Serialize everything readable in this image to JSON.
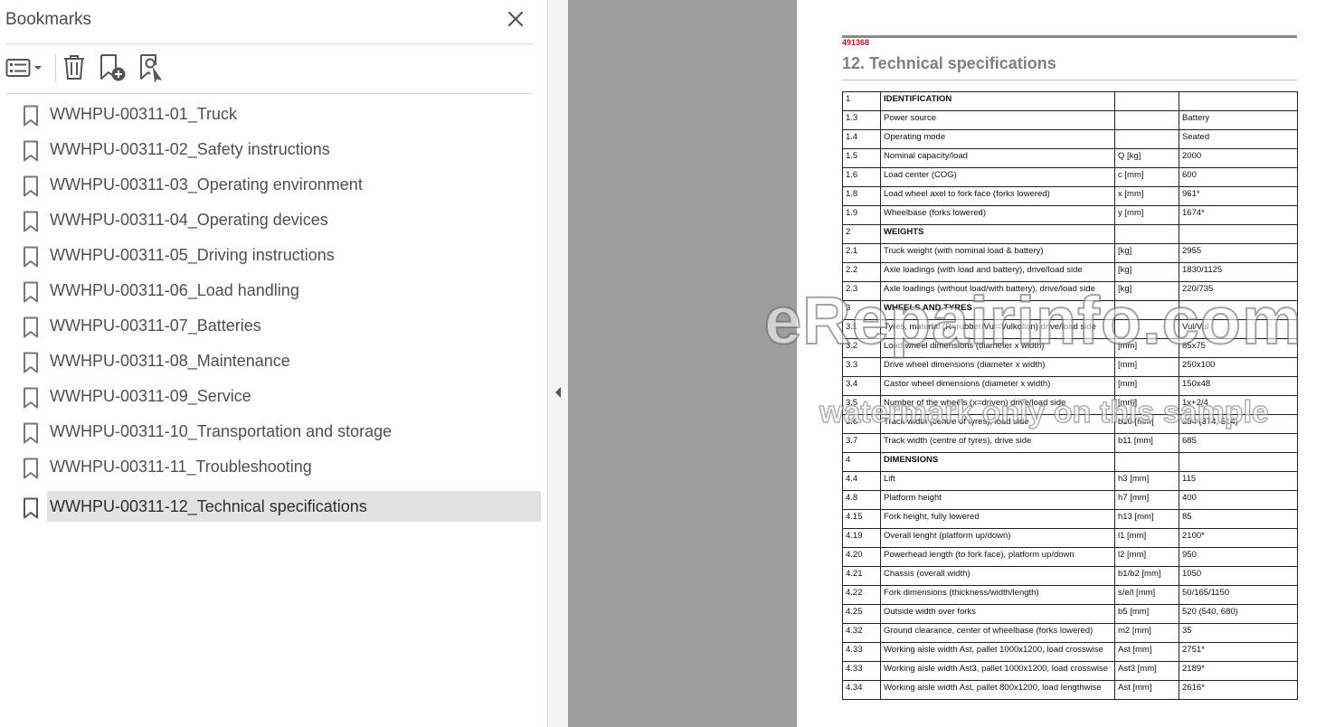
{
  "sidebar": {
    "title": "Bookmarks",
    "toolbar": {
      "options_icon": "options-list-icon",
      "delete_icon": "trash-icon",
      "new_bookmark_icon": "add-bookmark-icon",
      "find_bookmark_icon": "find-bookmark-icon"
    },
    "items": [
      {
        "label": "WWHPU-00311-01_Truck"
      },
      {
        "label": "WWHPU-00311-02_Safety instructions"
      },
      {
        "label": "WWHPU-00311-03_Operating environment"
      },
      {
        "label": "WWHPU-00311-04_Operating devices"
      },
      {
        "label": "WWHPU-00311-05_Driving instructions"
      },
      {
        "label": "WWHPU-00311-06_Load handling"
      },
      {
        "label": "WWHPU-00311-07_Batteries"
      },
      {
        "label": "WWHPU-00311-08_Maintenance"
      },
      {
        "label": "WWHPU-00311-09_Service"
      },
      {
        "label": "WWHPU-00311-10_Transportation and storage"
      },
      {
        "label": "WWHPU-00311-11_Troubleshooting"
      },
      {
        "label": "WWHPU-00311-12_Technical specifications",
        "selected": true
      }
    ]
  },
  "document": {
    "code": "491368",
    "title": "12. Technical specifications",
    "rows": [
      {
        "no": "1",
        "desc": "IDENTIFICATION",
        "unit": "",
        "value": "",
        "section": true
      },
      {
        "no": "1.3",
        "desc": "Power source",
        "unit": "",
        "value": "Battery"
      },
      {
        "no": "1.4",
        "desc": "Operating mode",
        "unit": "",
        "value": "Seated"
      },
      {
        "no": "1.5",
        "desc": "Nominal capacity/load",
        "unit": "Q [kg]",
        "value": "2000"
      },
      {
        "no": "1.6",
        "desc": "Load center (COG)",
        "unit": "c [mm]",
        "value": "600"
      },
      {
        "no": "1.8",
        "desc": "Load wheel axel to fork face (forks lowered)",
        "unit": "x [mm]",
        "value": "961*"
      },
      {
        "no": "1.9",
        "desc": "Wheelbase (forks lowered)",
        "unit": "y [mm]",
        "value": "1674*"
      },
      {
        "no": "2",
        "desc": "WEIGHTS",
        "unit": "",
        "value": "",
        "section": true
      },
      {
        "no": "2.1",
        "desc": "Truck weight (with nominal load & battery)",
        "unit": "[kg]",
        "value": "2955"
      },
      {
        "no": "2.2",
        "desc": "Axle loadings (with load and battery), drive/load side",
        "unit": "[kg]",
        "value": "1830/1125"
      },
      {
        "no": "2.3",
        "desc": "Axle loadings (without load/with battery), drive/load side",
        "unit": "[kg]",
        "value": "220/735"
      },
      {
        "no": "3",
        "desc": "WHEELS AND TYRES",
        "unit": "",
        "value": "",
        "section": true
      },
      {
        "no": "3.1",
        "desc": "Tyres, material (R=rubber/Vul=Vulkollan) drive/load side",
        "unit": "",
        "value": "Vul/Vul"
      },
      {
        "no": "3.2",
        "desc": "Load wheel dimensions (diameter x width)",
        "unit": "[mm]",
        "value": "85x75"
      },
      {
        "no": "3.3",
        "desc": "Drive wheel dimensions (diameter x width)",
        "unit": "[mm]",
        "value": "250x100"
      },
      {
        "no": "3.4",
        "desc": "Castor wheel dimensions (diameter x width)",
        "unit": "[mm]",
        "value": "150x48"
      },
      {
        "no": "3.5",
        "desc": "Number of the wheels (x=driven) drive/load side",
        "unit": "[mm]",
        "value": "1x+2/4"
      },
      {
        "no": "3.6",
        "desc": "Track width (centre of tyres), load side",
        "unit": "b10 [mm]",
        "value": "354 (374, 514)"
      },
      {
        "no": "3.7",
        "desc": "Track width (centre of tyres), drive side",
        "unit": "b11 [mm]",
        "value": "685"
      },
      {
        "no": "4",
        "desc": "DIMENSIONS",
        "unit": "",
        "value": "",
        "section": true
      },
      {
        "no": "4.4",
        "desc": "Lift",
        "unit": "h3 [mm]",
        "value": "115"
      },
      {
        "no": "4.8",
        "desc": "Platform height",
        "unit": "h7 [mm]",
        "value": "400"
      },
      {
        "no": "4.15",
        "desc": "Fork height, fully lowered",
        "unit": "h13 [mm]",
        "value": "85"
      },
      {
        "no": "4.19",
        "desc": "Overall lenght (platform up/down)",
        "unit": "l1 [mm]",
        "value": "2100*"
      },
      {
        "no": "4.20",
        "desc": "Powerhead length (to fork face), platform up/down",
        "unit": "l2 [mm]",
        "value": "950"
      },
      {
        "no": "4.21",
        "desc": "Chassis (overall width)",
        "unit": "b1/b2 [mm]",
        "value": "1050"
      },
      {
        "no": "4.22",
        "desc": "Fork dimensions (thickness/width/length)",
        "unit": "s/e/l [mm]",
        "value": "50/165/1150"
      },
      {
        "no": "4.25",
        "desc": "Outside width over forks",
        "unit": "b5 [mm]",
        "value": "520 (540, 680)"
      },
      {
        "no": "4.32",
        "desc": "Ground clearance, center of wheelbase (forks lowered)",
        "unit": "m2 [mm]",
        "value": "35"
      },
      {
        "no": "4.33",
        "desc": "Working aisle width Ast, pallet 1000x1200, load crosswise",
        "unit": "Ast [mm]",
        "value": "2751*"
      },
      {
        "no": "4.33",
        "desc": "Working aisle width Ast3, pallet 1000x1200, load crosswise",
        "unit": "Ast3 [mm]",
        "value": "2189*"
      },
      {
        "no": "4.34",
        "desc": "Working aisle width Ast, pallet 800x1200, load lengthwise",
        "unit": "Ast [mm]",
        "value": "2616*"
      }
    ]
  },
  "watermark": {
    "main": "eRepairinfo.com",
    "sub": "watermark only on this sample"
  },
  "colors": {
    "accent_code": "#b3162a",
    "grey_area": "#9d9d9d",
    "selected_bg": "#e2e2e2"
  }
}
